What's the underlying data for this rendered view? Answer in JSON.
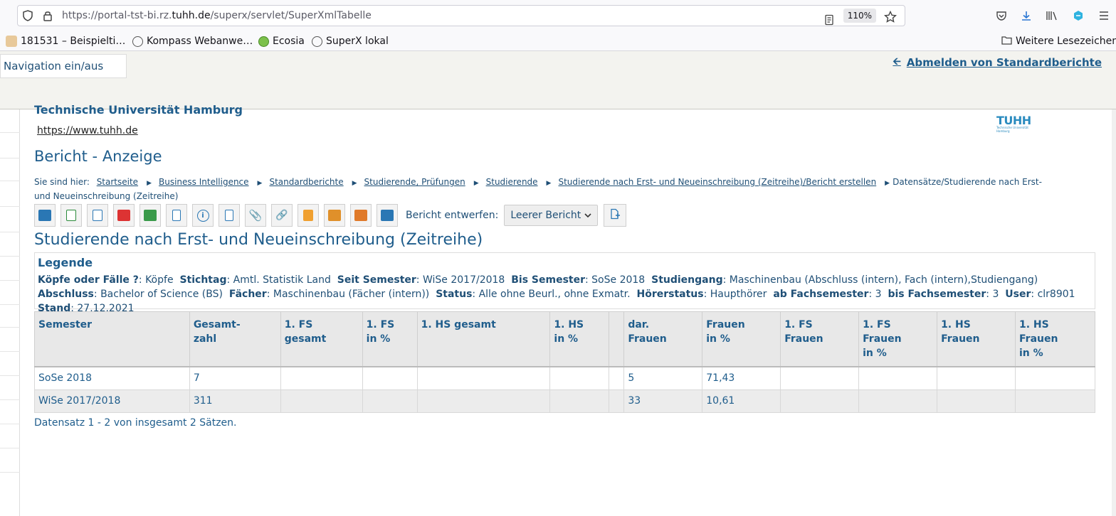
{
  "browser": {
    "url_prefix": "https://portal-tst-bi.rz.",
    "url_domain": "tuhh.de",
    "url_path": "/superx/servlet/SuperXmlTabelle",
    "zoom": "110%"
  },
  "bookmarks": [
    {
      "label": "181531 – Beispielti…"
    },
    {
      "label": "Kompass Webanwe…"
    },
    {
      "label": "Ecosia"
    },
    {
      "label": "SuperX lokal"
    }
  ],
  "bookmarks_other": "Weitere Lesezeichen",
  "header": {
    "nav_toggle": "Navigation ein/aus",
    "logout": "Abmelden von Standardberichte"
  },
  "org": {
    "name": "Technische Universität Hamburg",
    "url": "https://www.tuhh.de",
    "logo": "TUHH",
    "logo_sub": "Technische Universität Hamburg"
  },
  "page_title": "Bericht - Anzeige",
  "breadcrumb": {
    "prefix": "Sie sind hier:",
    "items": [
      "Startseite",
      "Business Intelligence",
      "Standardberichte",
      "Studierende, Prüfungen",
      "Studierende",
      "Studierende nach Erst- und Neueinschreibung (Zeitreihe)/Bericht erstellen"
    ],
    "current": "Datensätze/Studierende nach Erst- und Neueinschreibung (Zeitreihe)"
  },
  "toolbar": {
    "report_label": "Bericht entwerfen:",
    "report_select": "Leerer Bericht"
  },
  "report_title": "Studierende nach Erst- und Neueinschreibung (Zeitreihe)",
  "legend": {
    "title": "Legende",
    "entries": [
      {
        "k": "Köpfe oder Fälle ?",
        "v": "Köpfe"
      },
      {
        "k": "Stichtag",
        "v": "Amtl. Statistik Land"
      },
      {
        "k": "Seit Semester",
        "v": "WiSe 2017/2018"
      },
      {
        "k": "Bis Semester",
        "v": "SoSe 2018"
      },
      {
        "k": "Studiengang",
        "v": "Maschinenbau (Abschluss (intern), Fach (intern),Studiengang)"
      },
      {
        "k": "Abschluss",
        "v": "Bachelor of Science (BS)"
      },
      {
        "k": "Fächer",
        "v": "Maschinenbau (Fächer (intern))"
      },
      {
        "k": "Status",
        "v": "Alle ohne Beurl., ohne Exmatr."
      },
      {
        "k": "Hörerstatus",
        "v": "Haupthörer"
      },
      {
        "k": "ab Fachsemester",
        "v": "3"
      },
      {
        "k": "bis Fachsemester",
        "v": "3"
      },
      {
        "k": "User",
        "v": "clr8901"
      },
      {
        "k": "Stand",
        "v": "27.12.2021"
      }
    ]
  },
  "table": {
    "columns": [
      "Semester",
      "Gesamt-\nzahl",
      "1. FS\ngesamt",
      "1. FS\nin %",
      "1. HS gesamt",
      "1. HS\nin %",
      "",
      "dar.\nFrauen",
      "Frauen\nin %",
      "1. FS\nFrauen",
      "1. FS\nFrauen\nin %",
      "1. HS\nFrauen",
      "1. HS\nFrauen\nin %"
    ],
    "rows": [
      [
        "SoSe 2018",
        "7",
        "",
        "",
        "",
        "",
        "",
        "5",
        "71,43",
        "",
        "",
        "",
        ""
      ],
      [
        "WiSe 2017/2018",
        "311",
        "",
        "",
        "",
        "",
        "",
        "33",
        "10,61",
        "",
        "",
        "",
        ""
      ]
    ]
  },
  "footer": "Datensatz 1 - 2 von insgesamt 2 Sätzen.",
  "icons": [
    "shield-icon",
    "lock-icon",
    "reader-icon",
    "star-icon",
    "pocket-icon",
    "download-icon",
    "library-icon",
    "extension-icon",
    "menu-icon"
  ]
}
